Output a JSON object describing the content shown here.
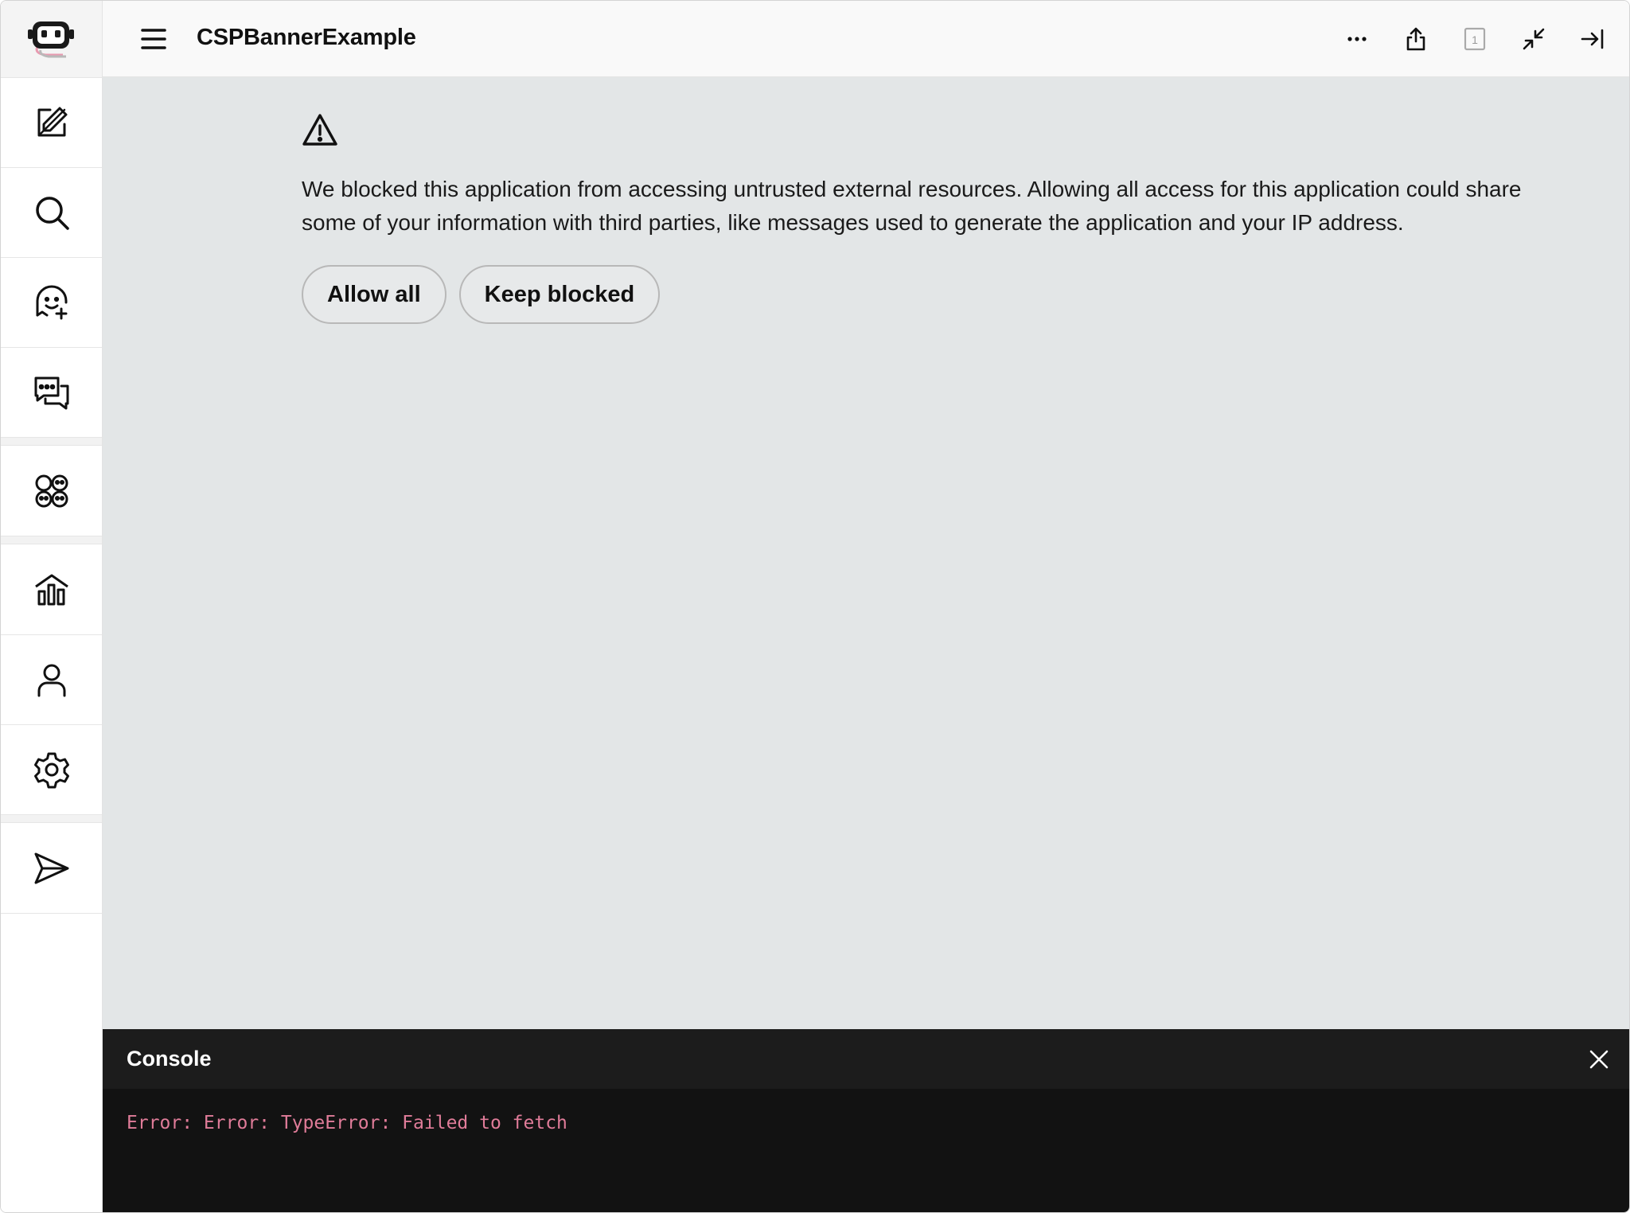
{
  "header": {
    "title": "CSPBannerExample",
    "badge_count": "1"
  },
  "sidebar": {
    "items": [
      {
        "icon": "robot-logo-icon"
      },
      {
        "icon": "edit-icon"
      },
      {
        "icon": "search-icon"
      },
      {
        "icon": "add-bot-icon"
      },
      {
        "icon": "chat-icon"
      },
      {
        "icon": "apps-icon"
      },
      {
        "icon": "analytics-icon"
      },
      {
        "icon": "user-icon"
      },
      {
        "icon": "settings-icon"
      },
      {
        "icon": "send-icon"
      }
    ]
  },
  "banner": {
    "message": "We blocked this application from accessing untrusted external resources. Allowing all access for this application could share some of your information with third parties, like messages used to generate the application and your IP address.",
    "allow_label": "Allow all",
    "keep_label": "Keep blocked"
  },
  "console": {
    "title": "Console",
    "lines": [
      "Error: Error: TypeError: Failed to fetch"
    ]
  },
  "colors": {
    "content_bg": "#e3e6e7",
    "console_bg": "#121212",
    "console_error": "#e07c99"
  }
}
